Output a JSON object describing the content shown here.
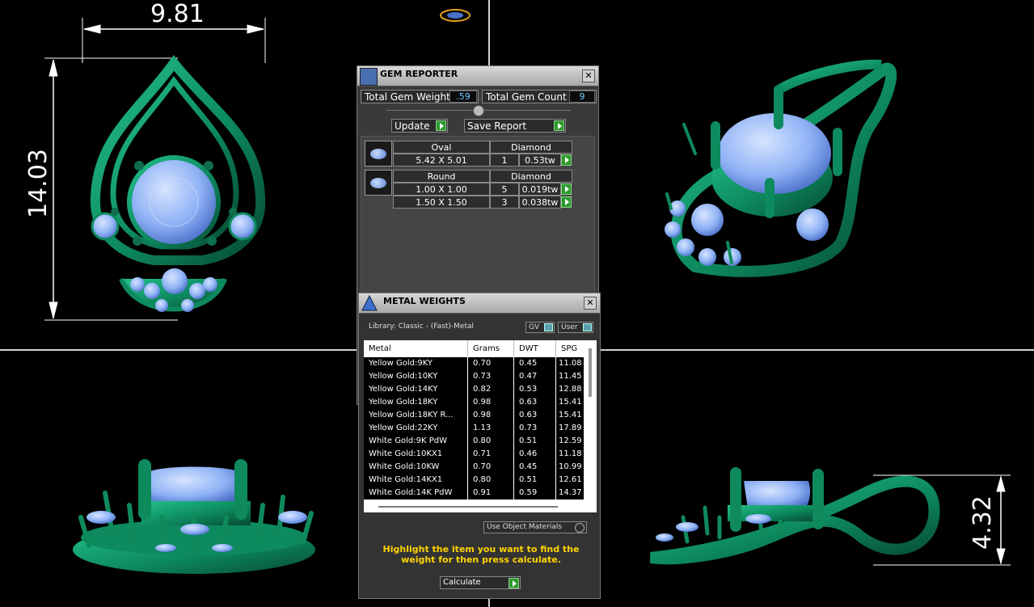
{
  "dimensions": {
    "top_width": "9.81",
    "left_height": "14.03",
    "right_height": "4.32"
  },
  "gem_reporter": {
    "title": "GEM REPORTER",
    "total_weight_label": "Total Gem Weight",
    "total_weight_value": ".59",
    "total_count_label": "Total Gem Count",
    "total_count_value": "9",
    "update_label": "Update",
    "save_report_label": "Save Report",
    "groups": [
      {
        "shape": "Oval",
        "type": "Diamond",
        "rows": [
          {
            "size": "5.42 X 5.01",
            "count": "1",
            "weight": "0.53tw"
          }
        ]
      },
      {
        "shape": "Round",
        "type": "Diamond",
        "rows": [
          {
            "size": "1.00 X 1.00",
            "count": "5",
            "weight": "0.019tw"
          },
          {
            "size": "1.50 X 1.50",
            "count": "3",
            "weight": "0.038tw"
          }
        ]
      }
    ]
  },
  "metal_weights": {
    "title": "METAL WEIGHTS",
    "library": "Library: Classic - (Fast)-Metal",
    "gv_label": "GV",
    "user_label": "User",
    "columns": [
      "Metal",
      "Grams",
      "DWT",
      "SPG"
    ],
    "rows": [
      [
        "Yellow Gold:9KY",
        "0.70",
        "0.45",
        "11.08"
      ],
      [
        "Yellow Gold:10KY",
        "0.73",
        "0.47",
        "11.45"
      ],
      [
        "Yellow Gold:14KY",
        "0.82",
        "0.53",
        "12.88"
      ],
      [
        "Yellow Gold:18KY",
        "0.98",
        "0.63",
        "15.41"
      ],
      [
        "Yellow Gold:18KY R...",
        "0.98",
        "0.63",
        "15.41"
      ],
      [
        "Yellow Gold:22KY",
        "1.13",
        "0.73",
        "17.89"
      ],
      [
        "White Gold:9K PdW",
        "0.80",
        "0.51",
        "12.59"
      ],
      [
        "White Gold:10KX1",
        "0.71",
        "0.46",
        "11.18"
      ],
      [
        "White Gold:10KW",
        "0.70",
        "0.45",
        "10.99"
      ],
      [
        "White Gold:14KX1",
        "0.80",
        "0.51",
        "12.61"
      ],
      [
        "White Gold:14K PdW",
        "0.91",
        "0.59",
        "14.37"
      ]
    ],
    "use_object_materials": "Use Object Materials",
    "hint": "Highlight the item you want to find the weight for then press calculate.",
    "calculate_label": "Calculate"
  },
  "colors": {
    "metal": "#0d8a5e",
    "gem": "#8fb2f5",
    "panel": "#3a3a3a",
    "accent_green": "#2d9a2d",
    "hint_yellow": "#ffd400"
  }
}
